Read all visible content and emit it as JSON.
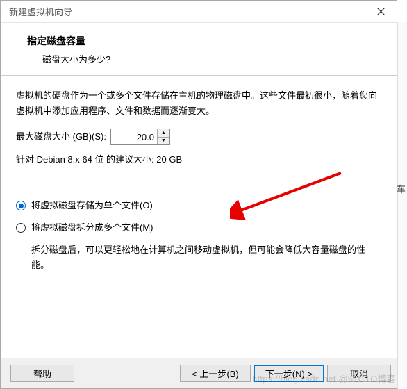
{
  "titlebar": {
    "title": "新建虚拟机向导"
  },
  "header": {
    "title": "指定磁盘容量",
    "subtitle": "磁盘大小为多少?"
  },
  "content": {
    "description": "虚拟机的硬盘作为一个或多个文件存储在主机的物理磁盘中。这些文件最初很小，随着您向虚拟机中添加应用程序、文件和数据而逐渐变大。",
    "max_size_label": "最大磁盘大小 (GB)(S):",
    "max_size_value": "20.0",
    "recommendation": "针对 Debian 8.x 64 位 的建议大小: 20 GB",
    "radios": {
      "single": "将虚拟磁盘存储为单个文件(O)",
      "split": "将虚拟磁盘拆分成多个文件(M)",
      "split_desc": "拆分磁盘后，可以更轻松地在计算机之间移动虚拟机，但可能会降低大容量磁盘的性能。"
    }
  },
  "buttons": {
    "help": "帮助",
    "back": "< 上一步(B)",
    "next": "下一步(N) >",
    "cancel": "取消"
  },
  "misc": {
    "sidebar_char": "车",
    "watermark": "https://blog.csdn.net @51CTO博客"
  }
}
